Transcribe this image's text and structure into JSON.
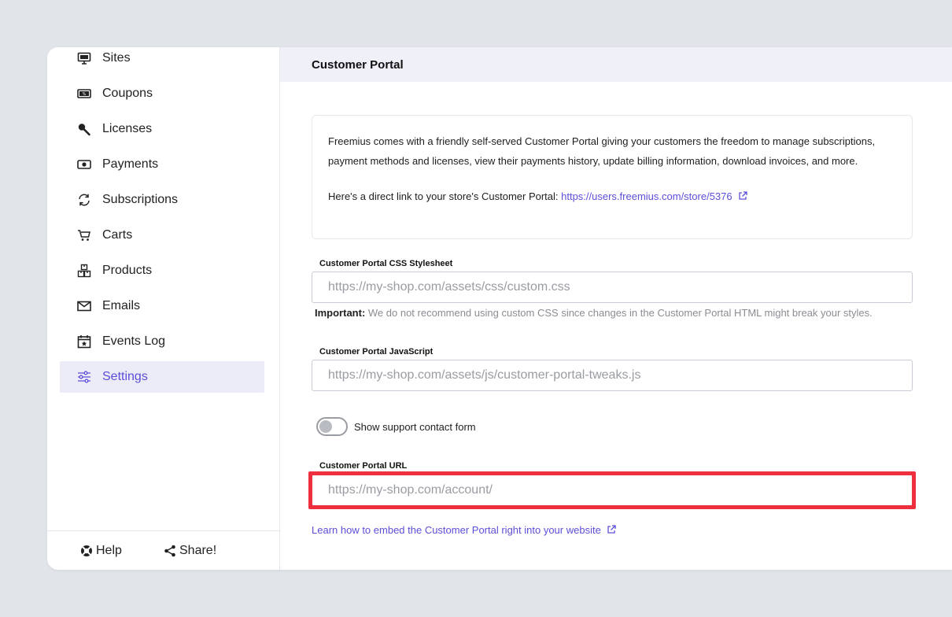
{
  "sidebar": {
    "items": [
      {
        "label": "Sites",
        "icon": "monitor-icon"
      },
      {
        "label": "Coupons",
        "icon": "coupon-icon"
      },
      {
        "label": "Licenses",
        "icon": "key-icon"
      },
      {
        "label": "Payments",
        "icon": "cash-icon"
      },
      {
        "label": "Subscriptions",
        "icon": "refresh-icon"
      },
      {
        "label": "Carts",
        "icon": "cart-icon"
      },
      {
        "label": "Products",
        "icon": "boxes-icon"
      },
      {
        "label": "Emails",
        "icon": "envelope-icon"
      },
      {
        "label": "Events Log",
        "icon": "calendar-icon"
      },
      {
        "label": "Settings",
        "icon": "sliders-icon",
        "active": true
      }
    ],
    "footer": {
      "help_label": "Help",
      "share_label": "Share!"
    }
  },
  "main": {
    "header_title": "Customer Portal",
    "info": {
      "paragraph": "Freemius comes with a friendly self-served Customer Portal giving your customers the freedom to manage subscriptions, payment methods and licenses, view their payments history, update billing information, download invoices, and more.",
      "direct_link_text": "Here's a direct link to your store's Customer Portal: ",
      "direct_link_url": "https://users.freemius.com/store/5376"
    },
    "css_field": {
      "label": "Customer Portal CSS Stylesheet",
      "placeholder": "https://my-shop.com/assets/css/custom.css",
      "value": ""
    },
    "css_note": {
      "strong": "Important:",
      "text": " We do not recommend using custom CSS since changes in the Customer Portal HTML might break your styles."
    },
    "js_field": {
      "label": "Customer Portal JavaScript",
      "placeholder": "https://my-shop.com/assets/js/customer-portal-tweaks.js",
      "value": ""
    },
    "support_toggle": {
      "label": "Show support contact form",
      "checked": false
    },
    "url_field": {
      "label": "Customer Portal URL",
      "placeholder": "https://my-shop.com/account/",
      "value": ""
    },
    "embed_link_text": "Learn how to embed the Customer Portal right into your website"
  },
  "colors": {
    "accent": "#5b4fd8",
    "active_bg": "#ecebf8",
    "highlight": "#ee2f3e",
    "page_bg": "#e1e5ea"
  }
}
